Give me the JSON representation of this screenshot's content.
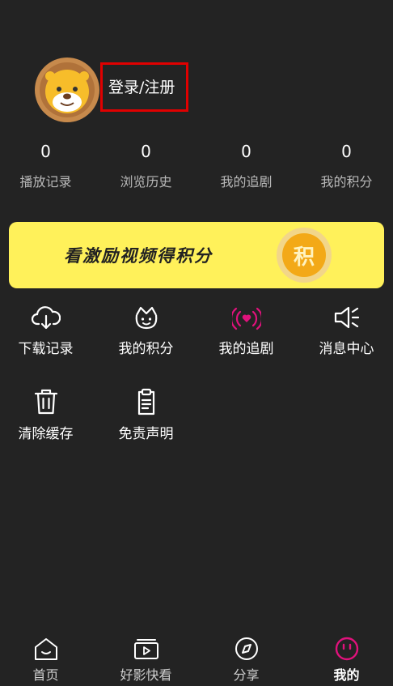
{
  "profile": {
    "login_label": "登录/注册",
    "avatar_icon": "lion-avatar-icon"
  },
  "stats": [
    {
      "value": "0",
      "label": "播放记录"
    },
    {
      "value": "0",
      "label": "浏览历史"
    },
    {
      "value": "0",
      "label": "我的追剧"
    },
    {
      "value": "0",
      "label": "我的积分"
    }
  ],
  "banner": {
    "text": "看激励视频得积分",
    "badge": "积",
    "color": "#fff15a",
    "badge_color": "#f3a917"
  },
  "menu": [
    {
      "label": "下载记录",
      "icon": "cloud-download-icon"
    },
    {
      "label": "我的积分",
      "icon": "crown-face-icon"
    },
    {
      "label": "我的追剧",
      "icon": "broadcast-heart-icon",
      "accent": "#e0127c"
    },
    {
      "label": "消息中心",
      "icon": "speaker-icon"
    },
    {
      "label": "清除缓存",
      "icon": "trash-icon"
    },
    {
      "label": "免责声明",
      "icon": "clipboard-icon"
    }
  ],
  "tabs": [
    {
      "label": "首页",
      "icon": "home-icon"
    },
    {
      "label": "好影快看",
      "icon": "video-player-icon"
    },
    {
      "label": "分享",
      "icon": "compass-icon"
    },
    {
      "label": "我的",
      "icon": "smiley-icon",
      "active": true,
      "accent": "#e0127c"
    }
  ]
}
